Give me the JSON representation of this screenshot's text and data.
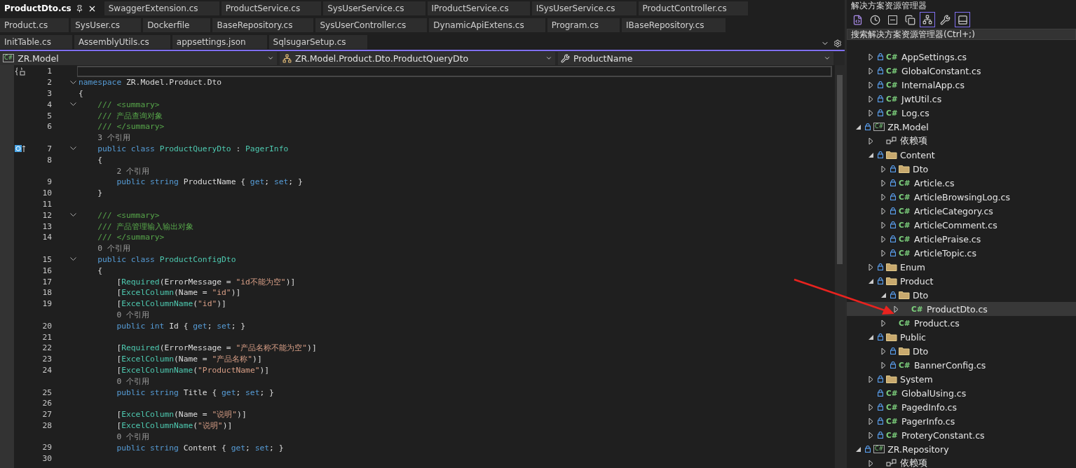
{
  "tab_rows": [
    [
      {
        "label": "ProductDto.cs",
        "selected": true
      },
      {
        "label": "SwaggerExtension.cs",
        "selected": false
      },
      {
        "label": "ProductService.cs",
        "selected": false
      },
      {
        "label": "SysUserService.cs",
        "selected": false
      },
      {
        "label": "IProductService.cs",
        "selected": false
      },
      {
        "label": "ISysUserService.cs",
        "selected": false
      },
      {
        "label": "ProductController.cs",
        "selected": false
      }
    ],
    [
      {
        "label": "Product.cs",
        "selected": false
      },
      {
        "label": "SysUser.cs",
        "selected": false
      },
      {
        "label": "Dockerfile",
        "selected": false
      },
      {
        "label": "BaseRepository.cs",
        "selected": false
      },
      {
        "label": "SysUserController.cs",
        "selected": false
      },
      {
        "label": "DynamicApiExtens.cs",
        "selected": false
      },
      {
        "label": "Program.cs",
        "selected": false
      },
      {
        "label": "IBaseRepository.cs",
        "selected": false
      }
    ],
    [
      {
        "label": "InitTable.cs",
        "selected": false
      },
      {
        "label": "AssemblyUtils.cs",
        "selected": false
      },
      {
        "label": "appsettings.json",
        "selected": false
      },
      {
        "label": "SqlsugarSetup.cs",
        "selected": false
      }
    ]
  ],
  "nav_bar": {
    "project": {
      "glyph": "C#",
      "label": "ZR.Model"
    },
    "type": "ZR.Model.Product.Dto.ProductQueryDto",
    "member": "ProductName"
  },
  "code_lines": [
    {
      "kind": "code",
      "number": "1",
      "marker": {
        "kind": "scope"
      },
      "current": true
    },
    {
      "kind": "code",
      "number": "2",
      "fold": true,
      "tokens": [
        {
          "kind": "kw",
          "text": "namespace"
        },
        {
          "kind": "plain",
          "text": " ZR.Model.Product.Dto"
        }
      ]
    },
    {
      "kind": "code",
      "number": "3",
      "tokens": [
        {
          "kind": "plain",
          "text": "{"
        }
      ]
    },
    {
      "kind": "code",
      "number": "4",
      "fold": true,
      "tokens": [
        {
          "kind": "cmt",
          "text": "    /// <summary>"
        }
      ]
    },
    {
      "kind": "code",
      "number": "5",
      "tokens": [
        {
          "kind": "cmt",
          "text": "    /// 产品查询对象"
        }
      ]
    },
    {
      "kind": "code",
      "number": "6",
      "tokens": [
        {
          "kind": "cmt",
          "text": "    /// </summary>"
        }
      ]
    },
    {
      "kind": "lens",
      "text": "    3 个引用"
    },
    {
      "kind": "code",
      "number": "7",
      "marker": {
        "kind": "implements"
      },
      "fold": true,
      "tokens": [
        {
          "kind": "kw",
          "text": "    public class"
        },
        {
          "kind": "type",
          "text": " ProductQueryDto"
        },
        {
          "kind": "plain",
          "text": " : "
        },
        {
          "kind": "type",
          "text": "PagerInfo"
        }
      ]
    },
    {
      "kind": "code",
      "number": "8",
      "tokens": [
        {
          "kind": "plain",
          "text": "    {"
        }
      ]
    },
    {
      "kind": "lens",
      "text": "        2 个引用"
    },
    {
      "kind": "code",
      "number": "9",
      "tokens": [
        {
          "kind": "kw",
          "text": "        public string"
        },
        {
          "kind": "plain",
          "text": " ProductName { "
        },
        {
          "kind": "kw",
          "text": "get"
        },
        {
          "kind": "plain",
          "text": "; "
        },
        {
          "kind": "kw",
          "text": "set"
        },
        {
          "kind": "plain",
          "text": "; }"
        }
      ]
    },
    {
      "kind": "code",
      "number": "10",
      "tokens": [
        {
          "kind": "plain",
          "text": "    }"
        }
      ]
    },
    {
      "kind": "code",
      "number": "11"
    },
    {
      "kind": "code",
      "number": "12",
      "fold": true,
      "tokens": [
        {
          "kind": "cmt",
          "text": "    /// <summary>"
        }
      ]
    },
    {
      "kind": "code",
      "number": "13",
      "tokens": [
        {
          "kind": "cmt",
          "text": "    /// 产品管理输入输出对象"
        }
      ]
    },
    {
      "kind": "code",
      "number": "14",
      "tokens": [
        {
          "kind": "cmt",
          "text": "    /// </summary>"
        }
      ]
    },
    {
      "kind": "lens",
      "text": "    0 个引用"
    },
    {
      "kind": "code",
      "number": "15",
      "fold": true,
      "tokens": [
        {
          "kind": "kw",
          "text": "    public class"
        },
        {
          "kind": "type",
          "text": " ProductConfigDto"
        }
      ]
    },
    {
      "kind": "code",
      "number": "16",
      "tokens": [
        {
          "kind": "plain",
          "text": "    {"
        }
      ]
    },
    {
      "kind": "code",
      "number": "17",
      "tokens": [
        {
          "kind": "plain",
          "text": "        ["
        },
        {
          "kind": "type",
          "text": "Required"
        },
        {
          "kind": "plain",
          "text": "(ErrorMessage = "
        },
        {
          "kind": "str",
          "text": "\"id不能为空\""
        },
        {
          "kind": "plain",
          "text": ")]"
        }
      ]
    },
    {
      "kind": "code",
      "number": "18",
      "tokens": [
        {
          "kind": "plain",
          "text": "        ["
        },
        {
          "kind": "type",
          "text": "ExcelColumn"
        },
        {
          "kind": "plain",
          "text": "(Name = "
        },
        {
          "kind": "str",
          "text": "\"id\""
        },
        {
          "kind": "plain",
          "text": ")]"
        }
      ]
    },
    {
      "kind": "code",
      "number": "19",
      "tokens": [
        {
          "kind": "plain",
          "text": "        ["
        },
        {
          "kind": "type",
          "text": "ExcelColumnName"
        },
        {
          "kind": "plain",
          "text": "("
        },
        {
          "kind": "str",
          "text": "\"id\""
        },
        {
          "kind": "plain",
          "text": ")]"
        }
      ]
    },
    {
      "kind": "lens",
      "text": "        0 个引用"
    },
    {
      "kind": "code",
      "number": "20",
      "tokens": [
        {
          "kind": "kw",
          "text": "        public int"
        },
        {
          "kind": "plain",
          "text": " Id { "
        },
        {
          "kind": "kw",
          "text": "get"
        },
        {
          "kind": "plain",
          "text": "; "
        },
        {
          "kind": "kw",
          "text": "set"
        },
        {
          "kind": "plain",
          "text": "; }"
        }
      ]
    },
    {
      "kind": "code",
      "number": "21"
    },
    {
      "kind": "code",
      "number": "22",
      "tokens": [
        {
          "kind": "plain",
          "text": "        ["
        },
        {
          "kind": "type",
          "text": "Required"
        },
        {
          "kind": "plain",
          "text": "(ErrorMessage = "
        },
        {
          "kind": "str",
          "text": "\"产品名称不能为空\""
        },
        {
          "kind": "plain",
          "text": ")]"
        }
      ]
    },
    {
      "kind": "code",
      "number": "23",
      "tokens": [
        {
          "kind": "plain",
          "text": "        ["
        },
        {
          "kind": "type",
          "text": "ExcelColumn"
        },
        {
          "kind": "plain",
          "text": "(Name = "
        },
        {
          "kind": "str",
          "text": "\"产品名称\""
        },
        {
          "kind": "plain",
          "text": ")]"
        }
      ]
    },
    {
      "kind": "code",
      "number": "24",
      "tokens": [
        {
          "kind": "plain",
          "text": "        ["
        },
        {
          "kind": "type",
          "text": "ExcelColumnName"
        },
        {
          "kind": "plain",
          "text": "("
        },
        {
          "kind": "str",
          "text": "\"ProductName\""
        },
        {
          "kind": "plain",
          "text": ")]"
        }
      ]
    },
    {
      "kind": "lens",
      "text": "        0 个引用"
    },
    {
      "kind": "code",
      "number": "25",
      "tokens": [
        {
          "kind": "kw",
          "text": "        public string"
        },
        {
          "kind": "plain",
          "text": " Title { "
        },
        {
          "kind": "kw",
          "text": "get"
        },
        {
          "kind": "plain",
          "text": "; "
        },
        {
          "kind": "kw",
          "text": "set"
        },
        {
          "kind": "plain",
          "text": "; }"
        }
      ]
    },
    {
      "kind": "code",
      "number": "26"
    },
    {
      "kind": "code",
      "number": "27",
      "tokens": [
        {
          "kind": "plain",
          "text": "        ["
        },
        {
          "kind": "type",
          "text": "ExcelColumn"
        },
        {
          "kind": "plain",
          "text": "(Name = "
        },
        {
          "kind": "str",
          "text": "\"说明\""
        },
        {
          "kind": "plain",
          "text": ")]"
        }
      ]
    },
    {
      "kind": "code",
      "number": "28",
      "tokens": [
        {
          "kind": "plain",
          "text": "        ["
        },
        {
          "kind": "type",
          "text": "ExcelColumnName"
        },
        {
          "kind": "plain",
          "text": "("
        },
        {
          "kind": "str",
          "text": "\"说明\""
        },
        {
          "kind": "plain",
          "text": ")]"
        }
      ]
    },
    {
      "kind": "lens",
      "text": "        0 个引用"
    },
    {
      "kind": "code",
      "number": "29",
      "tokens": [
        {
          "kind": "kw",
          "text": "        public string"
        },
        {
          "kind": "plain",
          "text": " Content { "
        },
        {
          "kind": "kw",
          "text": "get"
        },
        {
          "kind": "plain",
          "text": "; "
        },
        {
          "kind": "kw",
          "text": "set"
        },
        {
          "kind": "plain",
          "text": "; }"
        }
      ]
    },
    {
      "kind": "code",
      "number": "30"
    }
  ],
  "solution_explorer": {
    "title": "解决方案资源管理器",
    "toolbar": [
      {
        "kind": "vs",
        "selected": false
      },
      {
        "kind": "history",
        "selected": false
      },
      {
        "kind": "collapse",
        "selected": false
      },
      {
        "kind": "copy",
        "selected": false
      },
      {
        "kind": "sync",
        "selected": true
      },
      {
        "kind": "wrench",
        "selected": false
      },
      {
        "kind": "preview",
        "selected": true
      }
    ],
    "search": {
      "placeholder": "搜索解决方案资源管理器(Ctrl+;)"
    },
    "partial_items": [
      {
        "label": "AppSettings.cs",
        "kind": "cs",
        "glyph": "C#",
        "locked": true,
        "expandable": true,
        "expanded": false,
        "selected": false
      },
      {
        "label": "GlobalConstant.cs",
        "kind": "cs",
        "glyph": "C#",
        "locked": true,
        "expandable": true,
        "expanded": false,
        "selected": false
      },
      {
        "label": "InternalApp.cs",
        "kind": "cs",
        "glyph": "C#",
        "locked": true,
        "expandable": true,
        "expanded": false,
        "selected": false
      },
      {
        "label": "JwtUtil.cs",
        "kind": "cs",
        "glyph": "C#",
        "locked": true,
        "expandable": true,
        "expanded": false,
        "selected": false
      },
      {
        "label": "Log.cs",
        "kind": "cs",
        "glyph": "C#",
        "locked": true,
        "expandable": true,
        "expanded": false,
        "selected": false
      }
    ],
    "projects": [
      {
        "label": "ZR.Model",
        "kind": "project",
        "glyph": "C#",
        "locked": true,
        "expandable": true,
        "expanded": true,
        "selected": false,
        "children": [
          {
            "label": "依赖项",
            "kind": "deps",
            "locked": false,
            "expandable": true,
            "expanded": false,
            "selected": false
          },
          {
            "label": "Content",
            "kind": "folder",
            "locked": true,
            "expandable": true,
            "expanded": true,
            "selected": false,
            "children": [
              {
                "label": "Dto",
                "kind": "folder",
                "locked": true,
                "expandable": true,
                "expanded": false,
                "selected": false
              },
              {
                "label": "Article.cs",
                "kind": "cs",
                "glyph": "C#",
                "locked": true,
                "expandable": true,
                "expanded": false,
                "selected": false
              },
              {
                "label": "ArticleBrowsingLog.cs",
                "kind": "cs",
                "glyph": "C#",
                "locked": true,
                "expandable": true,
                "expanded": false,
                "selected": false
              },
              {
                "label": "ArticleCategory.cs",
                "kind": "cs",
                "glyph": "C#",
                "locked": true,
                "expandable": true,
                "expanded": false,
                "selected": false
              },
              {
                "label": "ArticleComment.cs",
                "kind": "cs",
                "glyph": "C#",
                "locked": true,
                "expandable": true,
                "expanded": false,
                "selected": false
              },
              {
                "label": "ArticlePraise.cs",
                "kind": "cs",
                "glyph": "C#",
                "locked": true,
                "expandable": true,
                "expanded": false,
                "selected": false
              },
              {
                "label": "ArticleTopic.cs",
                "kind": "cs",
                "glyph": "C#",
                "locked": true,
                "expandable": true,
                "expanded": false,
                "selected": false
              }
            ]
          },
          {
            "label": "Enum",
            "kind": "folder",
            "locked": true,
            "expandable": true,
            "expanded": false,
            "selected": false
          },
          {
            "label": "Product",
            "kind": "folder",
            "locked": true,
            "expandable": true,
            "expanded": true,
            "selected": false,
            "children": [
              {
                "label": "Dto",
                "kind": "folder",
                "locked": true,
                "expandable": true,
                "expanded": true,
                "selected": false,
                "children": [
                  {
                    "label": "ProductDto.cs",
                    "kind": "cs",
                    "glyph": "C#",
                    "locked": false,
                    "expandable": true,
                    "expanded": false,
                    "selected": true
                  }
                ]
              },
              {
                "label": "Product.cs",
                "kind": "cs",
                "glyph": "C#",
                "locked": false,
                "expandable": true,
                "expanded": false,
                "selected": false
              }
            ]
          },
          {
            "label": "Public",
            "kind": "folder",
            "locked": true,
            "expandable": true,
            "expanded": true,
            "selected": false,
            "children": [
              {
                "label": "Dto",
                "kind": "folder",
                "locked": true,
                "expandable": true,
                "expanded": false,
                "selected": false
              },
              {
                "label": "BannerConfig.cs",
                "kind": "cs",
                "glyph": "C#",
                "locked": true,
                "expandable": true,
                "expanded": false,
                "selected": false
              }
            ]
          },
          {
            "label": "System",
            "kind": "folder",
            "locked": true,
            "expandable": true,
            "expanded": false,
            "selected": false
          },
          {
            "label": "GlobalUsing.cs",
            "kind": "cs",
            "glyph": "C#",
            "locked": true,
            "expandable": false,
            "selected": false
          },
          {
            "label": "PagedInfo.cs",
            "kind": "cs",
            "glyph": "C#",
            "locked": true,
            "expandable": true,
            "expanded": false,
            "selected": false
          },
          {
            "label": "PagerInfo.cs",
            "kind": "cs",
            "glyph": "C#",
            "locked": true,
            "expandable": true,
            "expanded": false,
            "selected": false
          },
          {
            "label": "ProteryConstant.cs",
            "kind": "cs",
            "glyph": "C#",
            "locked": true,
            "expandable": true,
            "expanded": false,
            "selected": false
          }
        ]
      },
      {
        "label": "ZR.Repository",
        "kind": "project",
        "glyph": "C#",
        "locked": true,
        "expandable": true,
        "expanded": true,
        "selected": false,
        "children": [
          {
            "label": "依赖项",
            "kind": "deps",
            "locked": false,
            "expandable": true,
            "expanded": false,
            "selected": false
          }
        ]
      }
    ]
  }
}
